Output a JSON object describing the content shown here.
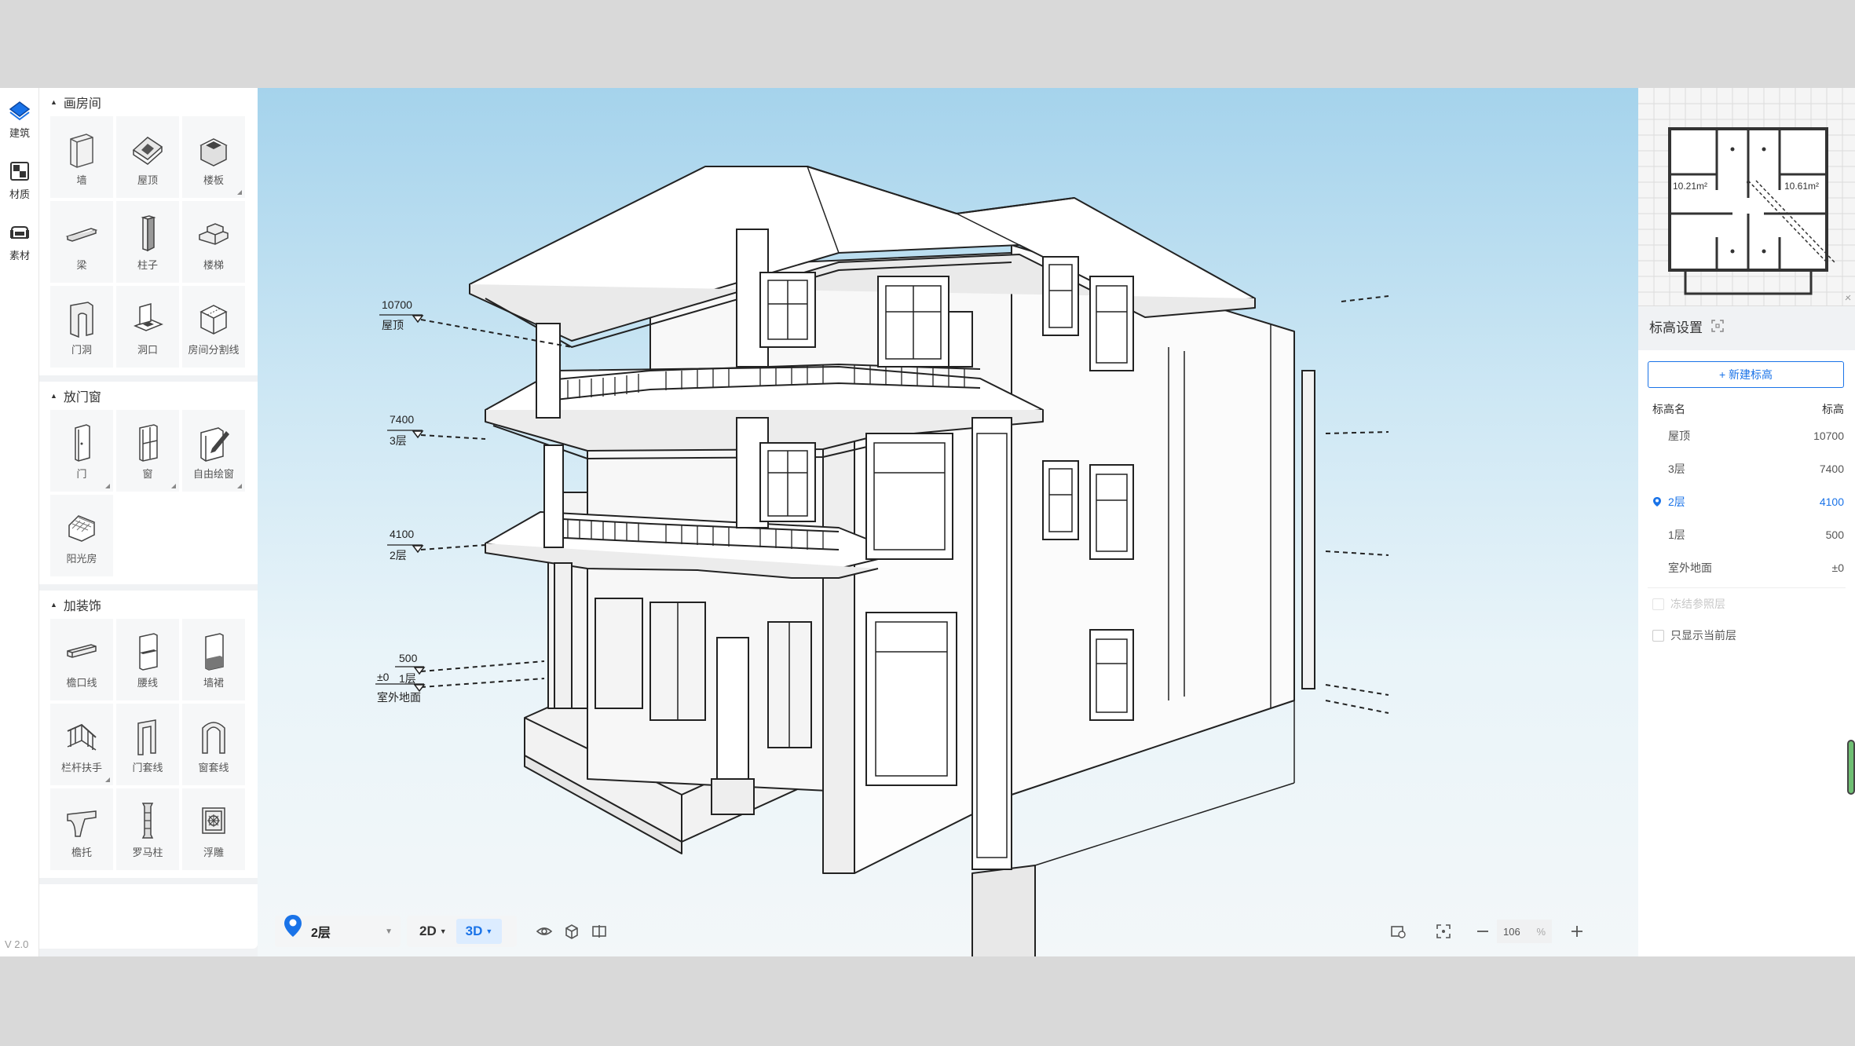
{
  "rail": {
    "items": [
      {
        "label": "建筑",
        "icon": "building-icon",
        "active": true
      },
      {
        "label": "材质",
        "icon": "material-icon",
        "active": false
      },
      {
        "label": "素材",
        "icon": "asset-icon",
        "active": false
      }
    ],
    "version": "V 2.0"
  },
  "panel": {
    "sections": [
      {
        "title": "画房间",
        "items": [
          {
            "label": "墙",
            "icon": "wall-icon",
            "more": false
          },
          {
            "label": "屋顶",
            "icon": "roof-icon",
            "more": false
          },
          {
            "label": "楼板",
            "icon": "floor-slab-icon",
            "more": true
          },
          {
            "label": "梁",
            "icon": "beam-icon",
            "more": false
          },
          {
            "label": "柱子",
            "icon": "column-icon",
            "more": false
          },
          {
            "label": "楼梯",
            "icon": "stairs-icon",
            "more": false
          },
          {
            "label": "门洞",
            "icon": "door-opening-icon",
            "more": false
          },
          {
            "label": "洞口",
            "icon": "hole-icon",
            "more": false
          },
          {
            "label": "房间分割线",
            "icon": "room-divider-icon",
            "more": false
          }
        ]
      },
      {
        "title": "放门窗",
        "items": [
          {
            "label": "门",
            "icon": "door-icon",
            "more": true
          },
          {
            "label": "窗",
            "icon": "window-icon",
            "more": true
          },
          {
            "label": "自由绘窗",
            "icon": "free-window-icon",
            "more": true
          },
          {
            "label": "阳光房",
            "icon": "sunroom-icon",
            "more": false
          }
        ]
      },
      {
        "title": "加装饰",
        "items": [
          {
            "label": "檐口线",
            "icon": "cornice-icon",
            "more": false
          },
          {
            "label": "腰线",
            "icon": "waistline-icon",
            "more": false
          },
          {
            "label": "墙裙",
            "icon": "wainscot-icon",
            "more": false
          },
          {
            "label": "栏杆扶手",
            "icon": "railing-icon",
            "more": true
          },
          {
            "label": "门套线",
            "icon": "door-trim-icon",
            "more": false
          },
          {
            "label": "窗套线",
            "icon": "window-trim-icon",
            "more": false
          },
          {
            "label": "檐托",
            "icon": "bracket-icon",
            "more": false
          },
          {
            "label": "罗马柱",
            "icon": "roman-column-icon",
            "more": false
          },
          {
            "label": "浮雕",
            "icon": "relief-icon",
            "more": false
          }
        ]
      }
    ]
  },
  "viewport": {
    "levels": [
      {
        "value": "10700",
        "name": "屋顶"
      },
      {
        "value": "7400",
        "name": "3层"
      },
      {
        "value": "4100",
        "name": "2层"
      },
      {
        "value": "500",
        "name": "1层"
      },
      {
        "value": "±0",
        "name": "室外地面"
      }
    ],
    "floor_select": "2层",
    "view_modes": [
      {
        "label": "2D",
        "active": false
      },
      {
        "label": "3D",
        "active": true
      }
    ],
    "zoom": "106",
    "zoom_unit": "%"
  },
  "minimap": {
    "room_labels": [
      "10.21m²",
      "10.61m²"
    ]
  },
  "elevation": {
    "title": "标高设置",
    "new_button": "+ 新建标高",
    "col_name": "标高名",
    "col_value": "标高",
    "rows": [
      {
        "name": "屋顶",
        "value": "10700",
        "active": false
      },
      {
        "name": "3层",
        "value": "7400",
        "active": false
      },
      {
        "name": "2层",
        "value": "4100",
        "active": true
      },
      {
        "name": "1层",
        "value": "500",
        "active": false
      },
      {
        "name": "室外地面",
        "value": "±0",
        "active": false
      }
    ],
    "freeze_label": "冻结参照层",
    "show_current_label": "只显示当前层"
  },
  "colors": {
    "accent": "#1a73e8",
    "sky_top": "#a5d3ec",
    "sky_bottom": "#f3f7f9"
  }
}
